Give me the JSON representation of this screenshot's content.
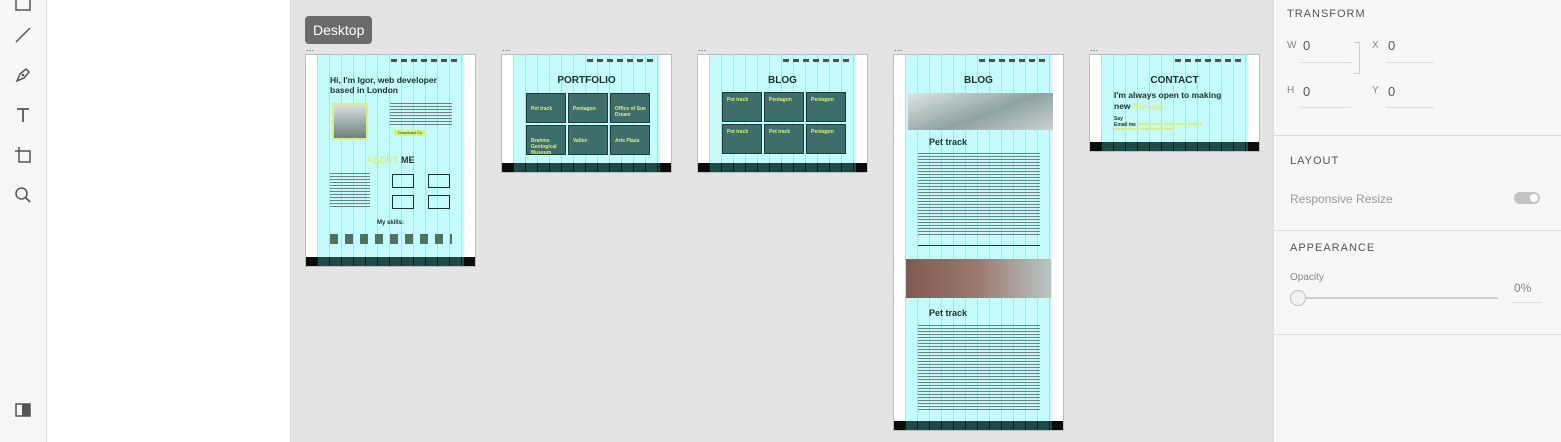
{
  "window": {
    "accent": "#d6f27c",
    "cyan": "#c6fbfb"
  },
  "toolbar": {
    "tools": [
      "rectangle-tool",
      "line-tool",
      "pen-tool",
      "text-tool",
      "artboard-tool",
      "zoom-tool"
    ],
    "bottom": "plugins-icon"
  },
  "canvas": {
    "tooltip": "Desktop",
    "artboard_menu": "...",
    "boards": {
      "home": {
        "hero": "Hi, I'm Igor, web developer based in London",
        "hero_accent": "Hi",
        "download": "Download Cv",
        "about_a": "ABOUT",
        "about_b": " ME",
        "skills": "My skills:"
      },
      "portfolio": {
        "title": "PORTFOLIO",
        "tiles": [
          "Pet track",
          "Pentagon",
          "Office of Sue Dream",
          "Brahms Geological Museum",
          "Vallee",
          "Arte Plaza"
        ]
      },
      "blog1": {
        "title": "BLOG",
        "tiles": [
          "Pet track",
          "Pentagon",
          "Pentagon",
          "Pet track",
          "Pet track",
          "Pentagon"
        ]
      },
      "blog2": {
        "title": "BLOG",
        "post1": "Pet track",
        "post2": "Pet track"
      },
      "contact": {
        "title": "CONTACT",
        "line1": "I'm always open to making",
        "line2a": "new ",
        "line2b": "friends.",
        "say": "Say",
        "email": "Email me"
      }
    }
  },
  "properties": {
    "transform": {
      "title": "TRANSFORM",
      "w_label": "W",
      "w": "0",
      "h_label": "H",
      "h": "0",
      "x_label": "X",
      "x": "0",
      "y_label": "Y",
      "y": "0"
    },
    "layout": {
      "title": "LAYOUT",
      "responsive": "Responsive Resize"
    },
    "appearance": {
      "title": "APPEARANCE",
      "opacity_label": "Opacity",
      "opacity": "0%"
    }
  }
}
